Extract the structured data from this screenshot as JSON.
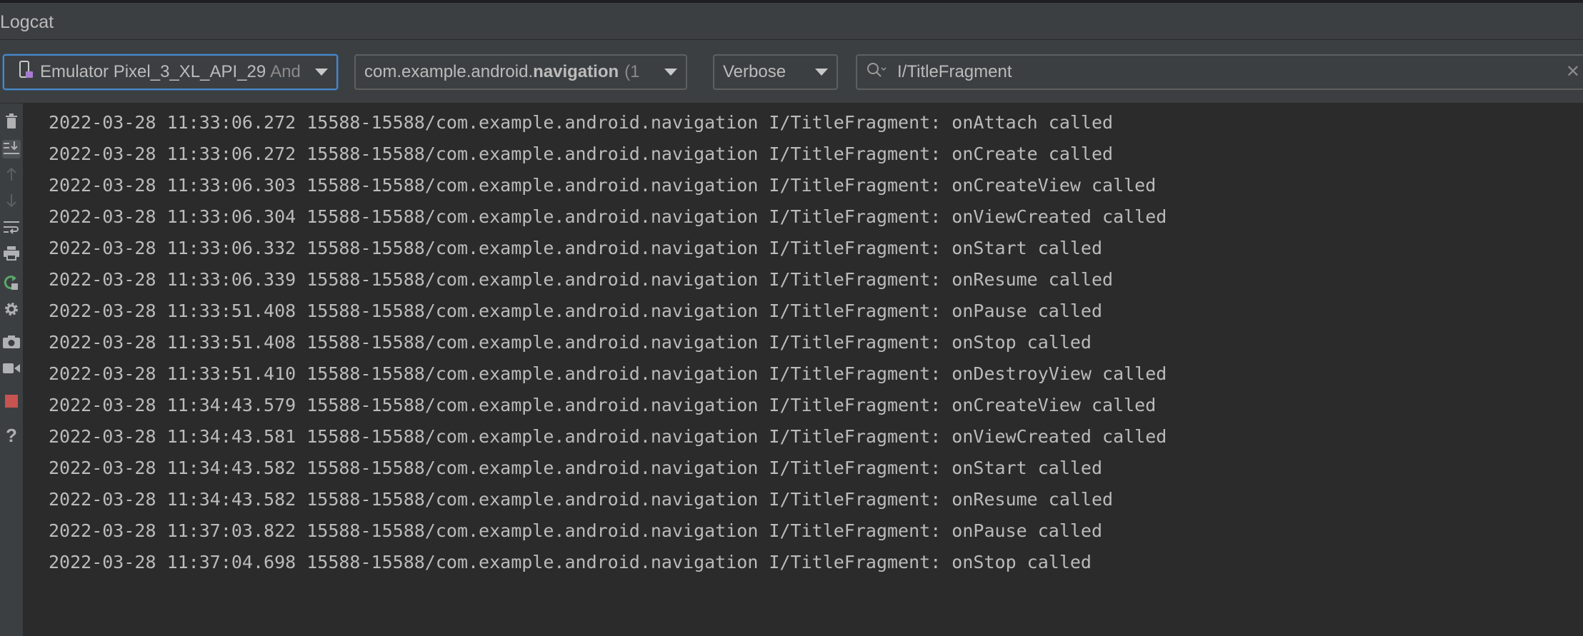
{
  "panel": {
    "title": "Logcat"
  },
  "toolbar": {
    "device": {
      "name": "Emulator Pixel_3_XL_API_29",
      "suffix": "And"
    },
    "process": {
      "prefix": "com.example.android.",
      "bold": "navigation",
      "suffix": "(1"
    },
    "log_level": "Verbose",
    "search": {
      "value": "I/TitleFragment"
    }
  },
  "sidebar": {
    "tools": [
      {
        "icon": "trash-icon",
        "action": "clear-logcat"
      },
      {
        "icon": "scroll-to-end-icon",
        "action": "scroll-to-end"
      },
      {
        "icon": "up-arrow-icon",
        "action": "previous-occurrence"
      },
      {
        "icon": "down-arrow-icon",
        "action": "next-occurrence"
      },
      {
        "icon": "soft-wrap-icon",
        "action": "soft-wraps"
      },
      {
        "icon": "print-icon",
        "action": "print"
      },
      {
        "icon": "restart-icon",
        "action": "restart"
      },
      {
        "icon": "gear-icon",
        "action": "settings"
      },
      {
        "icon": "camera-icon",
        "action": "screen-capture"
      },
      {
        "icon": "video-camera-icon",
        "action": "screen-record"
      },
      {
        "icon": "stop-icon",
        "action": "stop"
      },
      {
        "icon": "help-icon",
        "action": "help"
      }
    ]
  },
  "log": {
    "lines": [
      "2022-03-28 11:33:06.272 15588-15588/com.example.android.navigation I/TitleFragment: onAttach called",
      "2022-03-28 11:33:06.272 15588-15588/com.example.android.navigation I/TitleFragment: onCreate called",
      "2022-03-28 11:33:06.303 15588-15588/com.example.android.navigation I/TitleFragment: onCreateView called",
      "2022-03-28 11:33:06.304 15588-15588/com.example.android.navigation I/TitleFragment: onViewCreated called",
      "2022-03-28 11:33:06.332 15588-15588/com.example.android.navigation I/TitleFragment: onStart called",
      "2022-03-28 11:33:06.339 15588-15588/com.example.android.navigation I/TitleFragment: onResume called",
      "2022-03-28 11:33:51.408 15588-15588/com.example.android.navigation I/TitleFragment: onPause called",
      "2022-03-28 11:33:51.408 15588-15588/com.example.android.navigation I/TitleFragment: onStop called",
      "2022-03-28 11:33:51.410 15588-15588/com.example.android.navigation I/TitleFragment: onDestroyView called",
      "2022-03-28 11:34:43.579 15588-15588/com.example.android.navigation I/TitleFragment: onCreateView called",
      "2022-03-28 11:34:43.581 15588-15588/com.example.android.navigation I/TitleFragment: onViewCreated called",
      "2022-03-28 11:34:43.582 15588-15588/com.example.android.navigation I/TitleFragment: onStart called",
      "2022-03-28 11:34:43.582 15588-15588/com.example.android.navigation I/TitleFragment: onResume called",
      "2022-03-28 11:37:03.822 15588-15588/com.example.android.navigation I/TitleFragment: onPause called",
      "2022-03-28 11:37:04.698 15588-15588/com.example.android.navigation I/TitleFragment: onStop called"
    ]
  }
}
